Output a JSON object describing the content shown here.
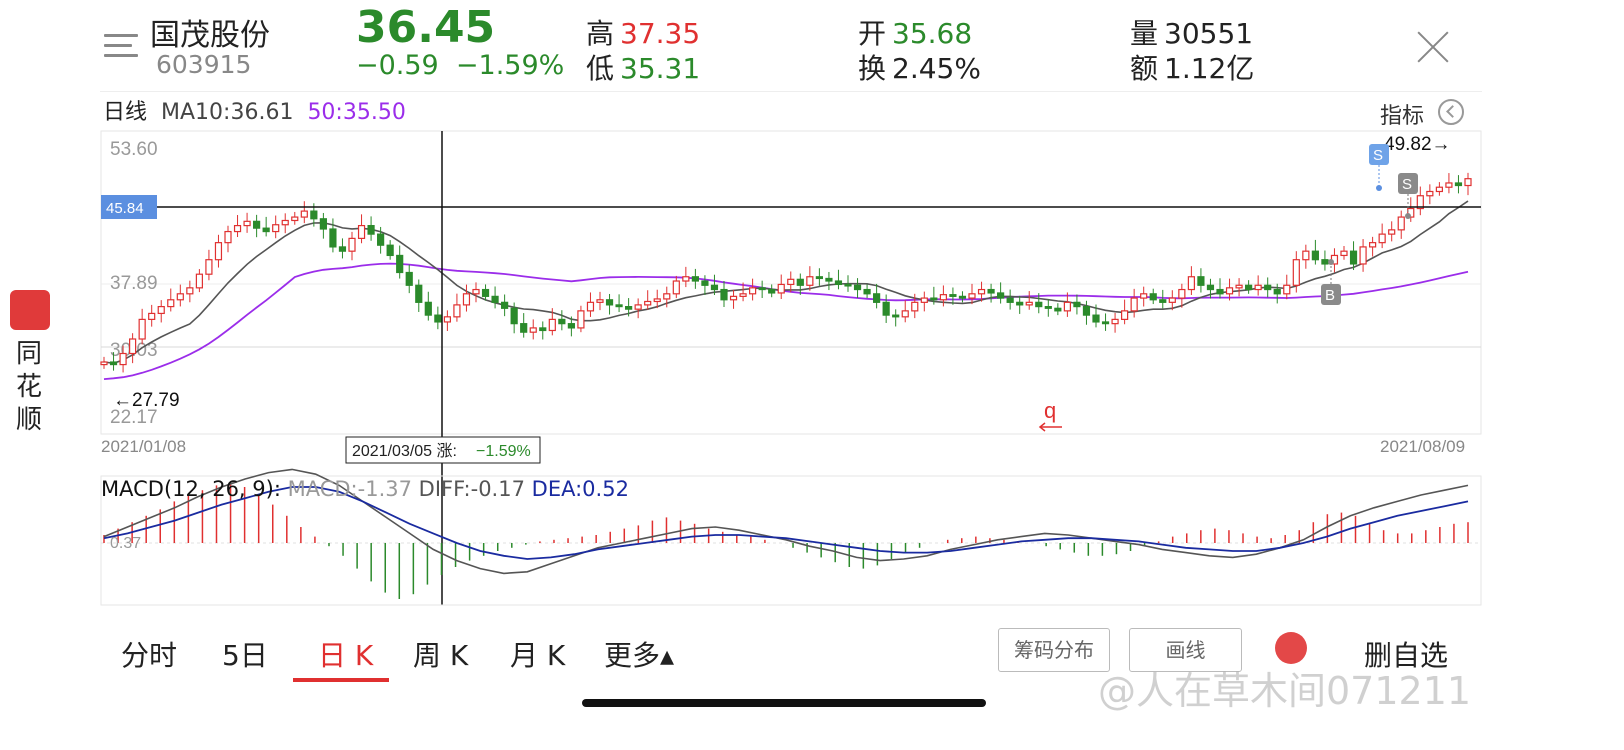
{
  "header": {
    "stock_name": "国茂股份",
    "stock_code": "603915",
    "price": "36.45",
    "change": "−0.59",
    "change_pct": "−1.59%",
    "high_label": "高",
    "high_value": "37.35",
    "low_label": "低",
    "low_value": "35.31",
    "open_label": "开",
    "open_value": "35.68",
    "turnover_label": "换",
    "turnover_value": "2.45%",
    "volume_label": "量",
    "volume_value": "30551",
    "amount_label": "额",
    "amount_value": "1.12亿"
  },
  "ma_bar": {
    "period": "日线",
    "ma10": "MA10:36.61",
    "ma50": "50:35.50",
    "indicator_label": "指标"
  },
  "sidebar": {
    "app_name": "同花顺"
  },
  "chart_data": [
    {
      "type": "candlestick",
      "y_ticks": [
        "53.60",
        "45.84",
        "37.89",
        "30.03",
        "22.17"
      ],
      "price_range": [
        22.17,
        53.6
      ],
      "start_date": "2021/01/08",
      "end_date": "2021/08/09",
      "crosshair": {
        "price": "45.84",
        "label": "2021/03/05 涨:",
        "pct": "−1.59%"
      },
      "max_label": "49.82→",
      "min_label": "←27.79",
      "signals": [
        "S",
        "S",
        "B"
      ],
      "annotation": "q",
      "close": [
        28.5,
        28.2,
        29.5,
        31.2,
        33.5,
        34.2,
        35.0,
        35.8,
        36.5,
        37.2,
        38.8,
        40.5,
        42.5,
        43.8,
        44.5,
        45.0,
        44.2,
        43.8,
        44.6,
        45.1,
        45.5,
        46.2,
        45.3,
        44.1,
        42.0,
        41.5,
        43.0,
        44.5,
        43.5,
        42.2,
        41.0,
        39.0,
        37.5,
        35.5,
        34.0,
        33.2,
        33.8,
        35.2,
        36.5,
        37.0,
        36.2,
        35.5,
        34.8,
        33.0,
        32.0,
        32.5,
        32.2,
        33.5,
        33.0,
        32.5,
        34.5,
        35.5,
        35.8,
        35.2,
        35.0,
        34.7,
        35.2,
        35.6,
        35.9,
        36.5,
        38.0,
        38.5,
        38.0,
        37.5,
        37.0,
        35.8,
        36.2,
        36.5,
        37.2,
        37.0,
        36.6,
        37.6,
        38.2,
        37.5,
        38.5,
        38.3,
        38.0,
        37.6,
        37.5,
        37.0,
        36.5,
        35.5,
        34.0,
        33.8,
        34.5,
        35.5,
        36.0,
        35.8,
        36.4,
        36.2,
        36.0,
        36.5,
        37.0,
        36.6,
        36.0,
        35.5,
        35.2,
        35.5,
        35.0,
        34.8,
        34.5,
        35.5,
        35.0,
        34.0,
        33.2,
        33.0,
        33.5,
        34.5,
        36.0,
        36.5,
        35.8,
        35.5,
        36.0,
        37.0,
        38.5,
        37.5,
        37.0,
        36.5,
        37.2,
        37.5,
        37.0,
        37.5,
        37.0,
        36.5,
        37.5,
        40.5,
        41.5,
        40.5,
        40.0,
        41.0,
        41.5,
        40.0,
        42.0,
        42.5,
        43.5,
        44.0,
        45.5,
        46.5,
        48.0,
        48.5,
        49.0,
        49.5,
        49.2,
        50.0
      ]
    },
    {
      "type": "bar",
      "title": "MACD(12, 26, 9):",
      "macd": "MACD:-1.37",
      "diff": "DIFF:-0.17",
      "dea": "DEA:0.52",
      "zero_label": "0.37",
      "values": [
        0.5,
        0.9,
        1.3,
        1.7,
        2.1,
        2.6,
        3.0,
        3.3,
        3.6,
        3.7,
        3.5,
        3.0,
        2.4,
        1.7,
        1.0,
        0.4,
        -0.2,
        -0.8,
        -1.6,
        -2.4,
        -3.1,
        -3.5,
        -3.2,
        -2.6,
        -2.0,
        -1.5,
        -1.1,
        -0.8,
        -0.5,
        -0.3,
        -0.1,
        0.1,
        0.2,
        0.3,
        0.4,
        0.5,
        0.7,
        0.9,
        1.1,
        1.4,
        1.6,
        1.4,
        1.2,
        0.9,
        0.7,
        0.5,
        0.4,
        0.2,
        0.0,
        -0.3,
        -0.6,
        -0.9,
        -1.2,
        -1.5,
        -1.6,
        -1.4,
        -1.0,
        -0.6,
        -0.3,
        0.0,
        0.2,
        0.3,
        0.4,
        0.3,
        0.2,
        0.1,
        0.0,
        -0.2,
        -0.4,
        -0.6,
        -0.8,
        -0.8,
        -0.7,
        -0.5,
        -0.2,
        0.1,
        0.4,
        0.6,
        0.8,
        0.9,
        0.8,
        0.6,
        0.4,
        0.3,
        0.5,
        0.8,
        1.3,
        1.8,
        1.9,
        1.7,
        1.2,
        0.8,
        0.6,
        0.6,
        0.8,
        1.0,
        1.2,
        1.3
      ],
      "diff_line": [
        0.4,
        1.0,
        1.6,
        2.2,
        2.9,
        3.5,
        4.0,
        4.4,
        4.6,
        4.3,
        3.6,
        2.6,
        1.6,
        0.6,
        -0.4,
        -1.1,
        -1.6,
        -1.9,
        -1.8,
        -1.3,
        -0.8,
        -0.3,
        0.0,
        0.3,
        0.6,
        0.9,
        1.0,
        0.8,
        0.5,
        0.2,
        -0.2,
        -0.5,
        -0.9,
        -1.1,
        -1.0,
        -0.8,
        -0.4,
        -0.1,
        0.2,
        0.4,
        0.6,
        0.5,
        0.3,
        0.1,
        -0.1,
        -0.4,
        -0.6,
        -0.8,
        -0.9,
        -0.7,
        -0.3,
        0.2,
        1.0,
        1.7,
        2.2,
        2.6,
        3.0,
        3.3,
        3.6
      ],
      "dea_line": [
        0.3,
        0.6,
        1.0,
        1.4,
        1.9,
        2.4,
        2.8,
        3.2,
        3.5,
        3.5,
        3.2,
        2.6,
        1.9,
        1.2,
        0.6,
        0.0,
        -0.5,
        -0.8,
        -1.0,
        -0.9,
        -0.7,
        -0.4,
        -0.2,
        0.0,
        0.2,
        0.4,
        0.5,
        0.5,
        0.4,
        0.3,
        0.1,
        -0.1,
        -0.3,
        -0.5,
        -0.6,
        -0.6,
        -0.5,
        -0.3,
        -0.1,
        0.1,
        0.2,
        0.3,
        0.3,
        0.2,
        0.1,
        -0.1,
        -0.3,
        -0.4,
        -0.5,
        -0.5,
        -0.3,
        0.0,
        0.4,
        0.9,
        1.3,
        1.7,
        2.0,
        2.3,
        2.6
      ]
    }
  ],
  "tabs": [
    "分时",
    "5日",
    "日 K",
    "周 K",
    "月 K",
    "更多▴"
  ],
  "buttons": {
    "chips": "筹码分布",
    "draw": "画线",
    "watchlist": "删自选"
  },
  "watermark": "@人在草木间071211",
  "colors": {
    "up": "#e03030",
    "down": "#2b8a2b",
    "ma10": "#555555",
    "ma50": "#9b2dea",
    "dea": "#1a2ba0"
  }
}
